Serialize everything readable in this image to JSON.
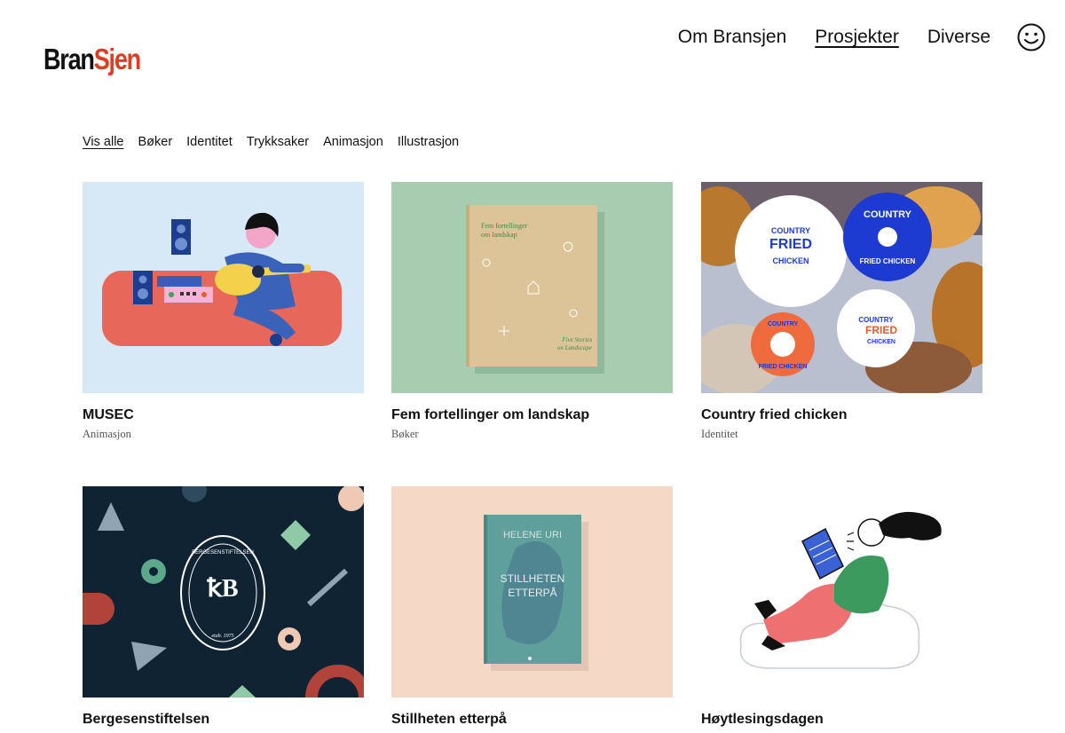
{
  "brand": {
    "logo_part1": "Bran",
    "logo_part2": "Sjen"
  },
  "nav": {
    "items": [
      {
        "label": "Om Bransjen",
        "active": false
      },
      {
        "label": "Prosjekter",
        "active": true
      },
      {
        "label": "Diverse",
        "active": false
      }
    ],
    "smiley_icon": "smiley-icon"
  },
  "filters": [
    {
      "label": "Vis alle",
      "active": true
    },
    {
      "label": "Bøker"
    },
    {
      "label": "Identitet"
    },
    {
      "label": "Trykksaker"
    },
    {
      "label": "Animasjon"
    },
    {
      "label": "Illustrasjon"
    }
  ],
  "projects": [
    {
      "title": "MUSEC",
      "category": "Animasjon"
    },
    {
      "title": "Fem fortellinger om landskap",
      "category": "Bøker",
      "cover_title": "Fem fortellinger om landskap",
      "cover_subtitle": "Five Stories on Landscape"
    },
    {
      "title": "Country fried chicken",
      "category": "Identitet",
      "sticker_text_1": "COUNTRY",
      "sticker_text_2": "FRIED",
      "sticker_text_3": "CHICKEN"
    },
    {
      "title": "Bergesenstiftelsen",
      "category": "",
      "seal_text": "BERGESENSTIFTELSEN",
      "seal_year": "etab. 1975"
    },
    {
      "title": "Stillheten etterpå",
      "category": "",
      "book_author": "HELENE URI",
      "book_title_1": "STILLHETEN",
      "book_title_2": "ETTERPÅ"
    },
    {
      "title": "Høytlesingsdagen",
      "category": ""
    }
  ],
  "colors": {
    "accent_red": "#e23b1f",
    "text": "#111111",
    "muted": "#555555"
  }
}
